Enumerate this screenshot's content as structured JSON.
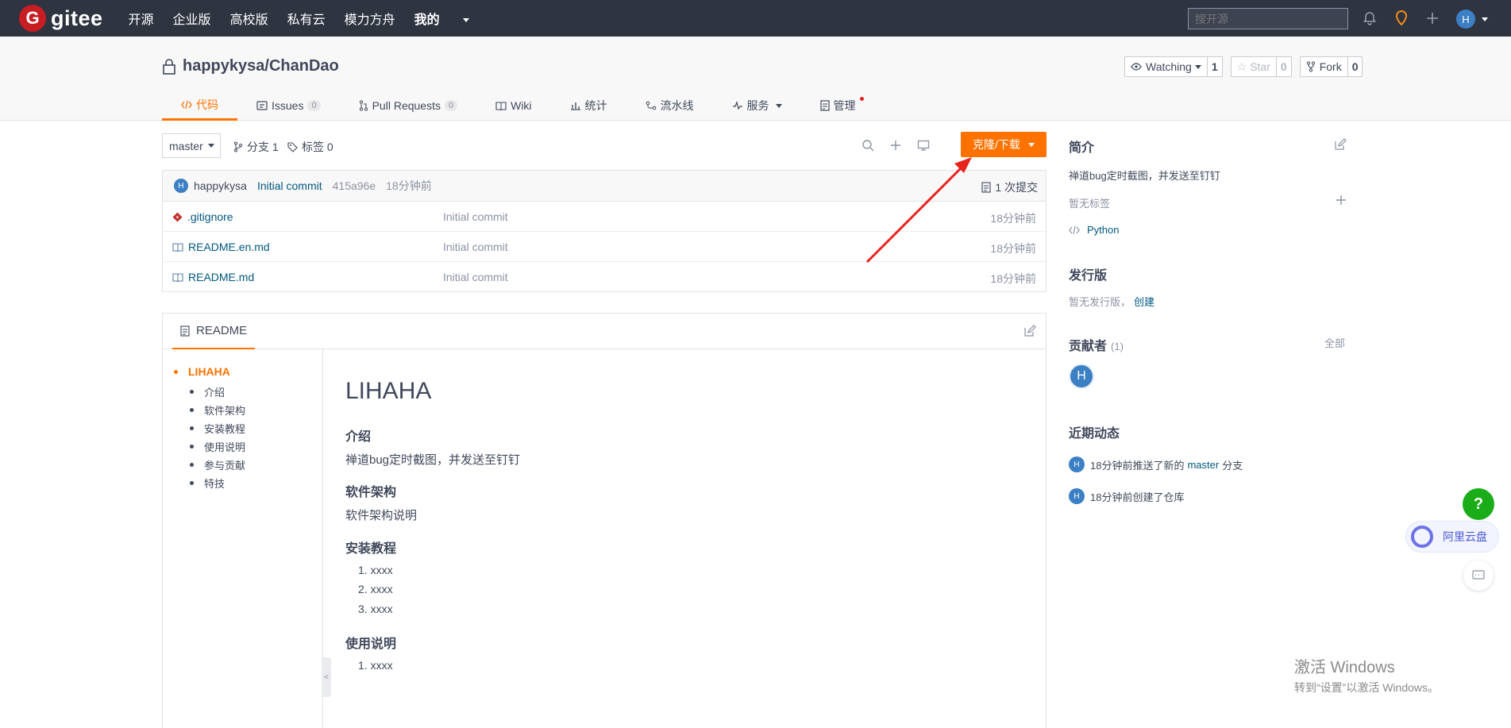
{
  "topnav": {
    "brand": "gitee",
    "links": [
      "开源",
      "企业版",
      "高校版",
      "私有云",
      "模力方舟"
    ],
    "mine": "我的",
    "search_placeholder": "搜开源",
    "avatar": "H"
  },
  "repo": {
    "path": "happykysa/ChanDao",
    "watch_label": "Watching",
    "watch_count": "1",
    "star_label": "Star",
    "star_count": "0",
    "fork_label": "Fork",
    "fork_count": "0"
  },
  "tabs": [
    {
      "label": "代码"
    },
    {
      "label": "Issues",
      "count": "0"
    },
    {
      "label": "Pull Requests",
      "count": "0"
    },
    {
      "label": "Wiki"
    },
    {
      "label": "统计"
    },
    {
      "label": "流水线"
    },
    {
      "label": "服务"
    },
    {
      "label": "管理"
    }
  ],
  "toolbar": {
    "branch": "master",
    "branches": "分支 1",
    "tags": "标签 0",
    "clone_label": "克隆/下载"
  },
  "commit": {
    "avatar": "H",
    "user": "happykysa",
    "message": "Initial commit",
    "hash": "415a96e",
    "time": "18分钟前",
    "count": "1 次提交"
  },
  "files": [
    {
      "name": ".gitignore",
      "message": "Initial commit",
      "time": "18分钟前"
    },
    {
      "name": "README.en.md",
      "message": "Initial commit",
      "time": "18分钟前"
    },
    {
      "name": "README.md",
      "message": "Initial commit",
      "time": "18分钟前"
    }
  ],
  "readme": {
    "tab": "README",
    "toc_top": "LIHAHA",
    "toc": [
      "介绍",
      "软件架构",
      "安装教程",
      "使用说明",
      "参与贡献",
      "特技"
    ],
    "h1": "LIHAHA",
    "intro_h": "介绍",
    "intro_p": "禅道bug定时截图，并发送至钉钉",
    "arch_h": "软件架构",
    "arch_p": "软件架构说明",
    "install_h": "安装教程",
    "install_items": [
      "1. xxxx",
      "2. xxxx",
      "3. xxxx"
    ],
    "usage_h": "使用说明",
    "usage_items": [
      "1. xxxx"
    ]
  },
  "sidebar": {
    "intro_title": "简介",
    "intro_desc": "禅道bug定时截图，并发送至钉钉",
    "no_tags": "暂无标签",
    "language": "Python",
    "release_title": "发行版",
    "no_release": "暂无发行版，",
    "create": "创建",
    "contrib_title": "贡献者",
    "contrib_count": "(1)",
    "all": "全部",
    "contrib_avatar": "H",
    "activity_title": "近期动态",
    "act1_pre": "18分钟前推送了新的",
    "act1_branch": "master",
    "act1_post": "分支",
    "act2": "18分钟前创建了仓库",
    "act_avatar": "H"
  },
  "widgets": {
    "help": "?",
    "aliyun": "阿里云盘"
  },
  "watermark": {
    "line1": "激活 Windows",
    "line2": "转到“设置”以激活 Windows。"
  },
  "colors": {
    "accent": "#fe7300",
    "nav_bg": "#2e3440",
    "link": "#005980"
  }
}
